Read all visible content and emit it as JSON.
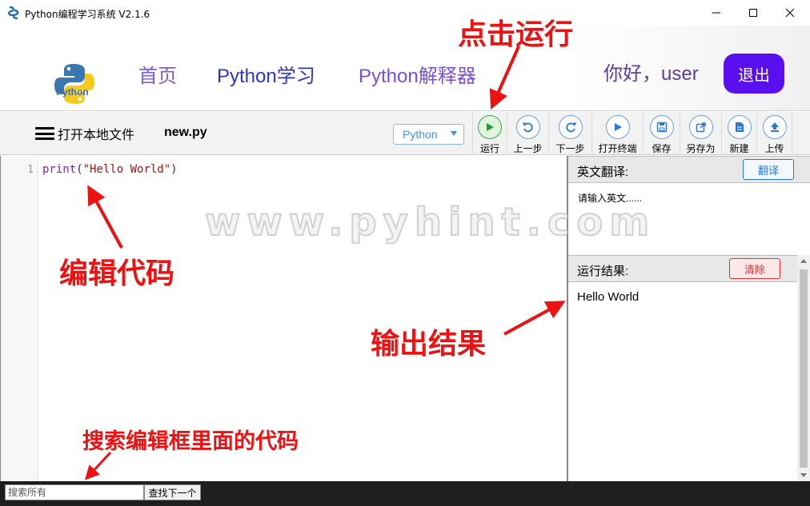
{
  "window": {
    "title": "Python编程学习系统 V2.1.6",
    "controls": [
      "minimize",
      "maximize",
      "close"
    ]
  },
  "header": {
    "logo_text": "Python",
    "nav": [
      {
        "label": "首页",
        "color": "#7a5fcf"
      },
      {
        "label": "Python学习",
        "color": "#2b36c7"
      },
      {
        "label": "Python解释器",
        "color": "#7a4fd4"
      }
    ],
    "greeting": "你好，user",
    "logout_label": "退出",
    "logout_color": "#5a0fee"
  },
  "toolbar": {
    "open_file_label": "打开本地文件",
    "filename": "new.py",
    "language": "Python",
    "tools": [
      {
        "label": "运行",
        "icon": "play-icon"
      },
      {
        "label": "上一步",
        "icon": "undo-icon"
      },
      {
        "label": "下一步",
        "icon": "redo-icon"
      },
      {
        "label": "打开终端",
        "icon": "terminal-play-icon"
      },
      {
        "label": "保存",
        "icon": "save-icon"
      },
      {
        "label": "另存为",
        "icon": "save-as-icon"
      },
      {
        "label": "新建",
        "icon": "new-file-icon"
      },
      {
        "label": "上传",
        "icon": "upload-icon"
      }
    ]
  },
  "editor": {
    "line_number": "1",
    "code_fn": "print",
    "code_open": "(",
    "code_str": "\"Hello World\"",
    "code_close": ")"
  },
  "translate_panel": {
    "title": "英文翻译:",
    "button": "翻译",
    "placeholder": "请输入英文......"
  },
  "output_panel": {
    "title": "运行结果:",
    "button": "清除",
    "output": "Hello World"
  },
  "search": {
    "placeholder": "搜索所有",
    "find_next": "查找下一个"
  },
  "watermark": "www.pyhint.com",
  "annotations": {
    "run": "点击运行",
    "edit": "编辑代码",
    "output": "输出结果",
    "search": "搜索编辑框里面的代码"
  }
}
